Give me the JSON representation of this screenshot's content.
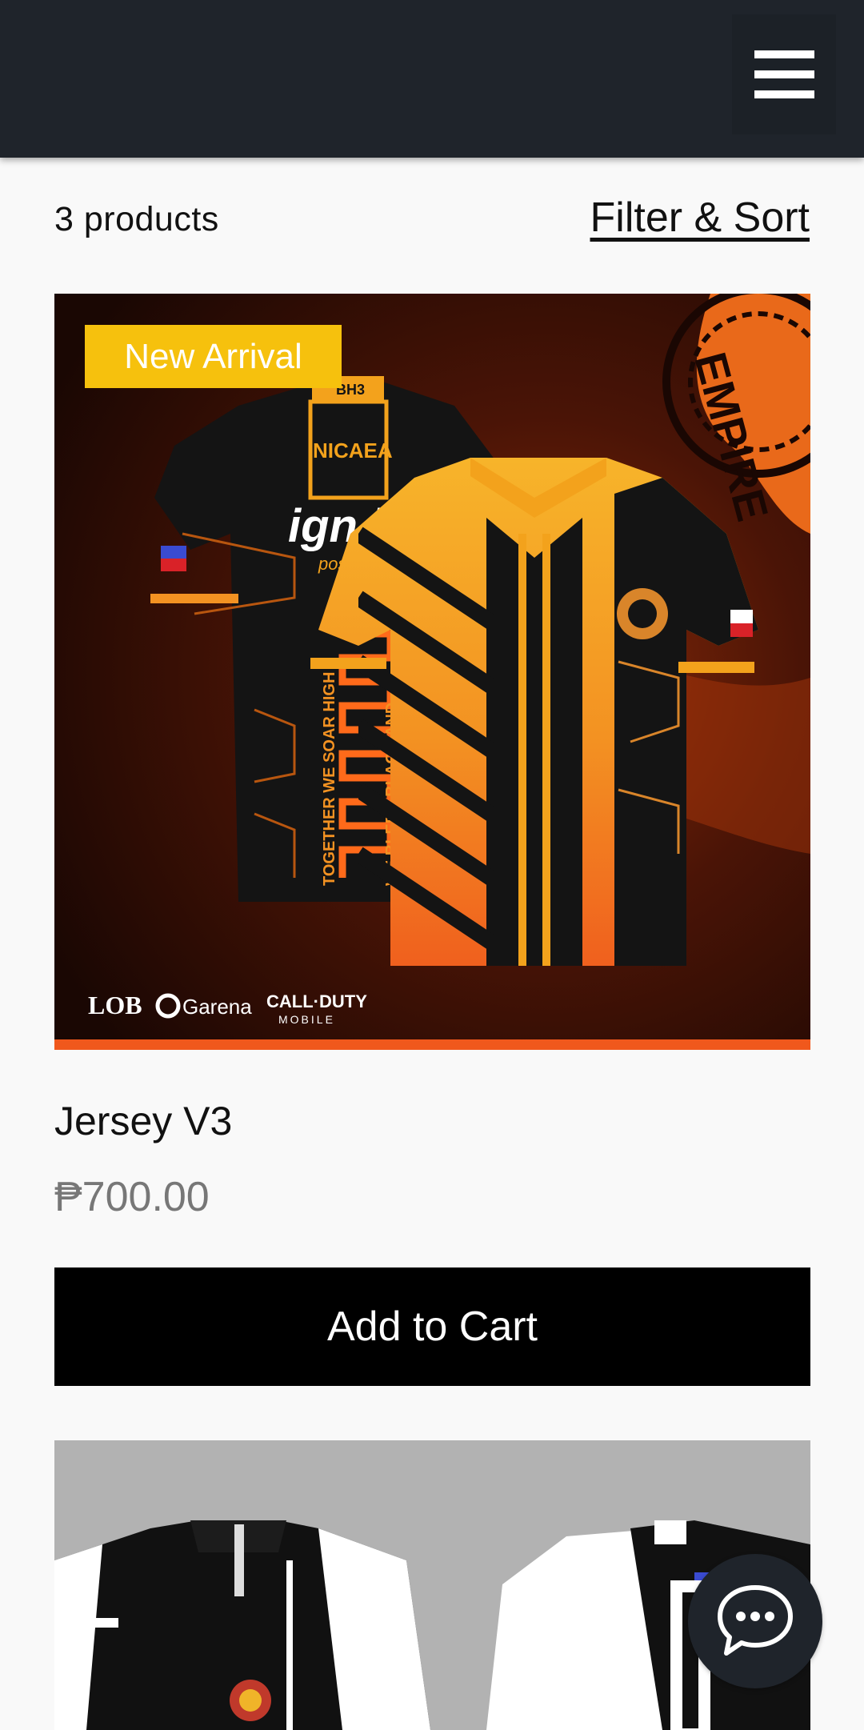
{
  "header": {
    "menu_icon": "hamburger-menu-icon"
  },
  "listing": {
    "count_label": "3 products",
    "filter_label": "Filter & Sort"
  },
  "products": [
    {
      "badge": "New Arrival",
      "name": "Jersey V3",
      "price": "₱700.00",
      "button_label": "Add to Cart",
      "image": {
        "jersey_back_text_1": "NICAEA",
        "jersey_back_text_2": "ign here",
        "jersey_back_text_3": "position here",
        "jersey_side_text_1": "TOGETHER WE SOAR HIGH",
        "jersey_side_text_2": "WE BLEED BLACK AND",
        "background_text": "EMPIRE",
        "sponsor_1": "LOB",
        "sponsor_2": "Garena",
        "sponsor_3": "CALL·DUTY",
        "sponsor_3_sub": "MOBILE",
        "collar_text": "BH3"
      }
    }
  ],
  "chat": {
    "icon": "chat-bubble-icon"
  },
  "colors": {
    "header_bg": "#1f242b",
    "badge_bg": "#f6c10d",
    "button_bg": "#000000",
    "page_bg": "#f9f9f9",
    "price": "#777777"
  }
}
